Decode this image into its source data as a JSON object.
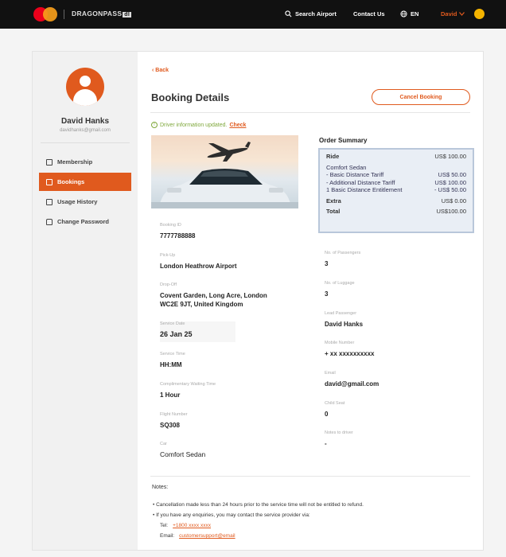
{
  "topbar": {
    "brand": "DRAGONPASS",
    "brand_badge": "dl",
    "search": "Search Airport",
    "contact": "Contact Us",
    "language": "EN",
    "user": "David"
  },
  "sidebar": {
    "name": "David Hanks",
    "email": "davidhanks@gmail.com",
    "items": [
      {
        "label": "Membership",
        "icon": "card-icon"
      },
      {
        "label": "Bookings",
        "icon": "calendar-icon",
        "active": true
      },
      {
        "label": "Usage History",
        "icon": "document-icon"
      },
      {
        "label": "Change Password",
        "icon": "lock-icon"
      }
    ]
  },
  "main": {
    "back": "Back",
    "title": "Booking Details",
    "cancel_button": "Cancel Booking",
    "notice_text": "Driver information updated.",
    "notice_link": "Check"
  },
  "fields_left": [
    {
      "label": "Booking ID",
      "value": "7777788888"
    },
    {
      "label": "Pick-Up",
      "value": "London Heathrow Airport"
    },
    {
      "label": "Drop-Off",
      "value": "Covent Garden, Long Acre, London WC2E 9JT, United Kingdom"
    },
    {
      "label": "Service Date",
      "value": "26 Jan 25"
    },
    {
      "label": "Service Time",
      "value": "HH:MM"
    },
    {
      "label": "Complimentary Waiting Time",
      "value": "1 Hour"
    },
    {
      "label": "Flight Number",
      "value": "SQ308"
    },
    {
      "label": "Car",
      "value": "Comfort Sedan"
    }
  ],
  "fields_right": [
    {
      "label": "No. of Passengers",
      "value": "3"
    },
    {
      "label": "No. of Luggage",
      "value": "3"
    },
    {
      "label": "Lead Passenger",
      "value": "David Hanks"
    },
    {
      "label": "Mobile Number",
      "value": "+ xx xxxxxxxxxx"
    },
    {
      "label": "Email",
      "value": "david@gmail.com"
    },
    {
      "label": "Child Seat",
      "value": "0"
    },
    {
      "label": "Notes to driver",
      "value": "-"
    }
  ],
  "order_summary": {
    "title": "Order Summary",
    "ride_label": "Ride",
    "ride_value": "US$ 100.00",
    "car_type": "Comfort Sedan",
    "lines": [
      {
        "label": "- Basic Distance Tariff",
        "value": "US$ 50.00"
      },
      {
        "label": "- Additional Distance Tariff",
        "value": "US$ 100.00"
      },
      {
        "label": "1 Basic Distance Entitlement",
        "value": "- US$ 50.00"
      }
    ],
    "extra_label": "Extra",
    "extra_value": "US$ 0.00",
    "total_label": "Total",
    "total_value": "US$100.00"
  },
  "notes": {
    "title": "Notes:",
    "line1": "• Cancellation made less than 24 hours prior to the service time will not be entitled to refund.",
    "line2": "• If you have any enquiries, you may contact the service provider via:",
    "tel_label": "Tel:",
    "tel_value": "+1800 xxxx xxxx",
    "email_label": "Email:",
    "email_value": "customersupport@email"
  },
  "colors": {
    "accent": "#e05a1e",
    "topbar": "#111111",
    "success": "#7fa83c"
  }
}
